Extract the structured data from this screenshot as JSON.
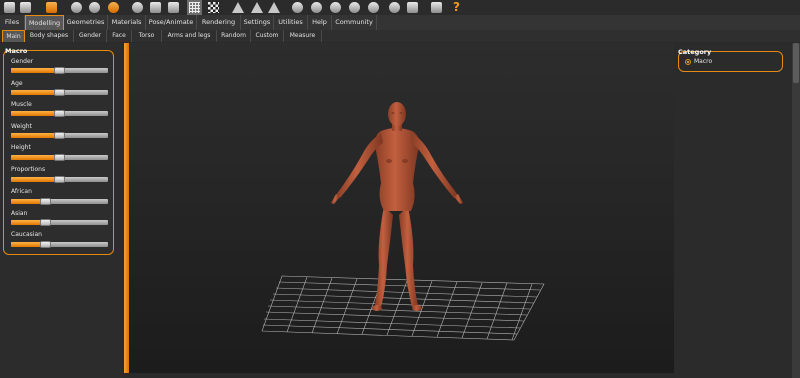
{
  "toolbar": {
    "icons": [
      "undo-icon",
      "redo-icon",
      "reset-icon",
      "smooth-icon",
      "wireframe-icon",
      "pose-icon",
      "grid-icon",
      "checker-icon",
      "front-view-icon",
      "back-view-icon",
      "left-view-icon",
      "right-view-icon",
      "top-view-icon",
      "bottom-view-icon",
      "camera-icon",
      "help-icon"
    ],
    "help_label": "?"
  },
  "menu": {
    "tabs": [
      "Files",
      "Modelling",
      "Geometries",
      "Materials",
      "Pose/Animate",
      "Rendering",
      "Settings",
      "Utilities",
      "Help",
      "Community"
    ],
    "active": "Modelling"
  },
  "subtabs": {
    "tabs": [
      "Main",
      "Body shapes",
      "Gender",
      "Face",
      "Torso",
      "Arms and legs",
      "Random",
      "Custom",
      "Measure"
    ],
    "active": "Main"
  },
  "macro": {
    "title": "Macro",
    "sliders": [
      {
        "label": "Gender",
        "value": 0.5
      },
      {
        "label": "Age",
        "value": 0.5
      },
      {
        "label": "Muscle",
        "value": 0.5
      },
      {
        "label": "Weight",
        "value": 0.5
      },
      {
        "label": "Height",
        "value": 0.5
      },
      {
        "label": "Proportions",
        "value": 0.5
      },
      {
        "label": "African",
        "value": 0.333
      },
      {
        "label": "Asian",
        "value": 0.333
      },
      {
        "label": "Caucasian",
        "value": 0.333
      }
    ]
  },
  "category": {
    "title": "Category",
    "option": "Macro"
  },
  "colors": {
    "accent": "#e58a12",
    "skin": "#b55a3c",
    "background": "#2a2a2a"
  }
}
